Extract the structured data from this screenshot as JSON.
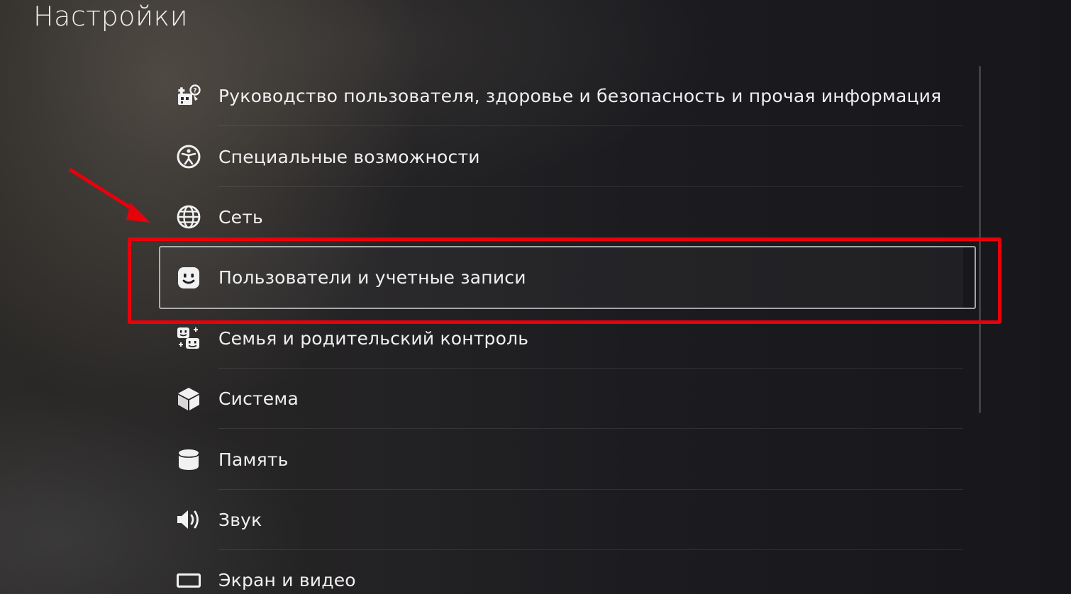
{
  "page": {
    "title": "Настройки"
  },
  "menu": {
    "items": [
      {
        "label": "Руководство пользователя, здоровье и безопасность и прочая информация",
        "icon": "user-guide-icon",
        "selected": false
      },
      {
        "label": "Специальные возможности",
        "icon": "accessibility-icon",
        "selected": false
      },
      {
        "label": "Сеть",
        "icon": "globe-icon",
        "selected": false
      },
      {
        "label": "Пользователи и учетные записи",
        "icon": "user-face-icon",
        "selected": true
      },
      {
        "label": "Семья и родительский контроль",
        "icon": "family-icon",
        "selected": false
      },
      {
        "label": "Система",
        "icon": "cube-icon",
        "selected": false
      },
      {
        "label": "Память",
        "icon": "storage-icon",
        "selected": false
      },
      {
        "label": "Звук",
        "icon": "speaker-icon",
        "selected": false
      },
      {
        "label": "Экран и видео",
        "icon": "display-icon",
        "selected": false
      }
    ]
  },
  "colors": {
    "annotation": "#e8000b",
    "text": "#f0f0f0"
  }
}
